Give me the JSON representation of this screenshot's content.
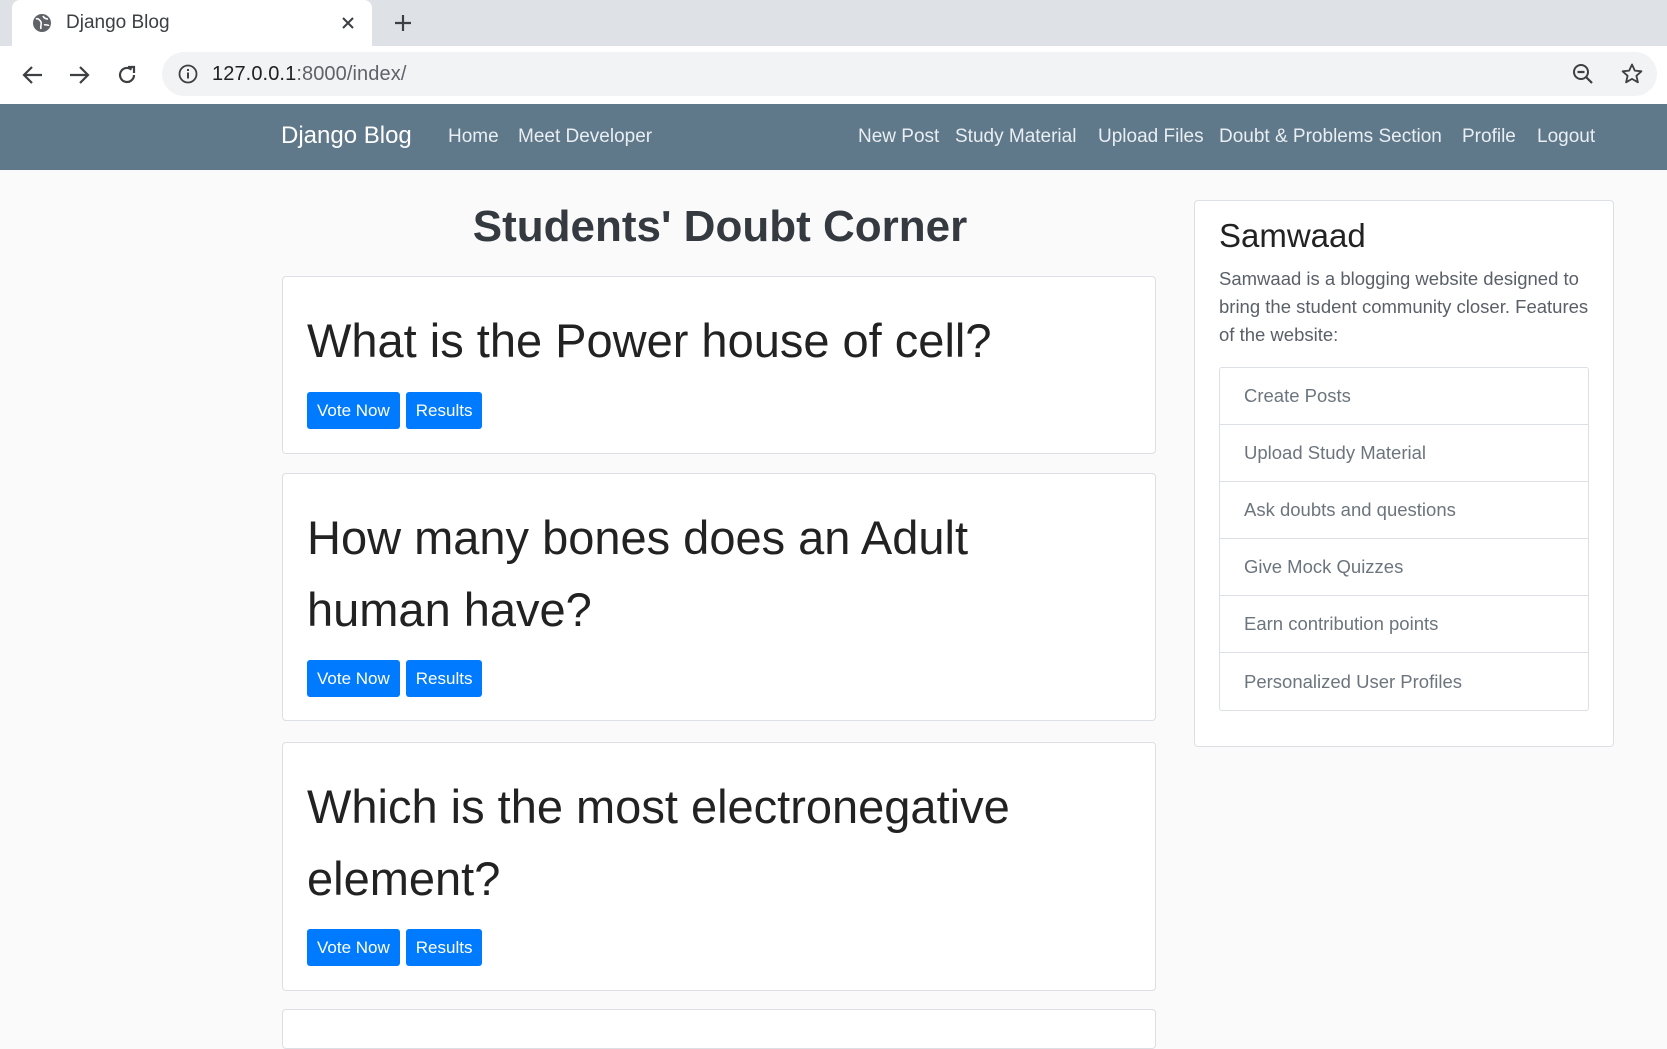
{
  "browser": {
    "tab_title": "Django Blog",
    "url_host": "127.0.0.1",
    "url_rest": ":8000/index/"
  },
  "navbar": {
    "brand": "Django Blog",
    "left_links": [
      "Home",
      "Meet Developer"
    ],
    "right_links": [
      "New Post",
      "Study Material",
      "Upload Files",
      "Doubt & Problems Section",
      "Profile",
      "Logout"
    ],
    "background": "#5f788a"
  },
  "main": {
    "heading": "Students' Doubt Corner",
    "questions": [
      {
        "title": "What is the Power house of cell?",
        "vote_label": "Vote Now",
        "results_label": "Results"
      },
      {
        "title": "How many bones does an Adult human have?",
        "vote_label": "Vote Now",
        "results_label": "Results"
      },
      {
        "title": "Which is the most electronegative element?",
        "vote_label": "Vote Now",
        "results_label": "Results"
      }
    ],
    "button_color": "#007bff"
  },
  "sidebar": {
    "title": "Samwaad",
    "description": "Samwaad is a blogging website designed to bring the student community closer. Features of the website:",
    "features": [
      "Create Posts",
      "Upload Study Material",
      "Ask doubts and questions",
      "Give Mock Quizzes",
      "Earn contribution points",
      "Personalized User Profiles"
    ]
  }
}
